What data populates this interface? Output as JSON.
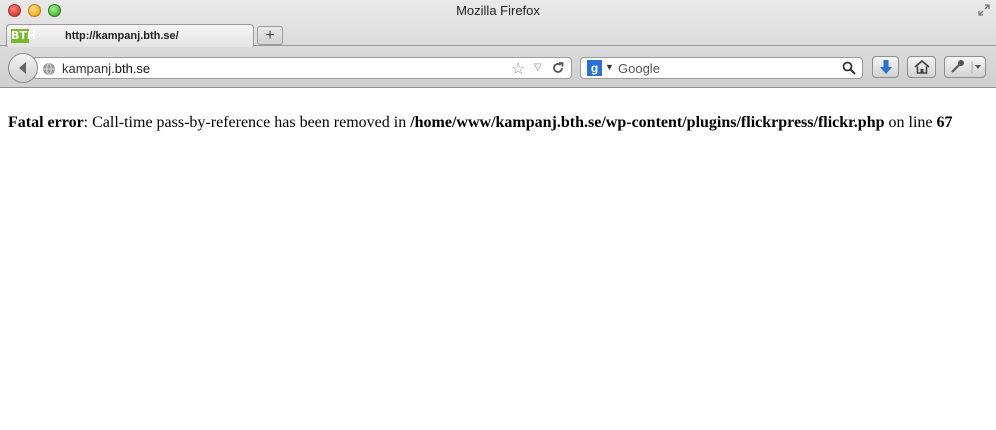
{
  "window": {
    "title": "Mozilla Firefox"
  },
  "tab": {
    "favicon_text": "BTH",
    "title": "http://kampanj.bth.se/",
    "new_tab_label": "+"
  },
  "navbar": {
    "url_prefix": "kampanj.",
    "url_host": "bth.se",
    "search_engine_letter": "g",
    "search_placeholder": "Google"
  },
  "page": {
    "error_label": "Fatal error",
    "error_message": ": Call-time pass-by-reference has been removed in ",
    "error_file": "/home/www/kampanj.bth.se/wp-content/plugins/flickrpress/flickr.php",
    "error_line_prefix": " on line ",
    "error_line": "67"
  },
  "icons": [
    "close-icon",
    "minimize-icon",
    "zoom-icon",
    "fullscreen-icon",
    "back-icon",
    "globe-icon",
    "star-icon",
    "dropmarker-icon",
    "reload-icon",
    "google-icon",
    "search-icon",
    "download-icon",
    "home-icon",
    "tools-icon"
  ],
  "colors": {
    "chrome": "#d6d6d6",
    "download_accent": "#2a6fd6",
    "favicon": "#7ab829"
  }
}
